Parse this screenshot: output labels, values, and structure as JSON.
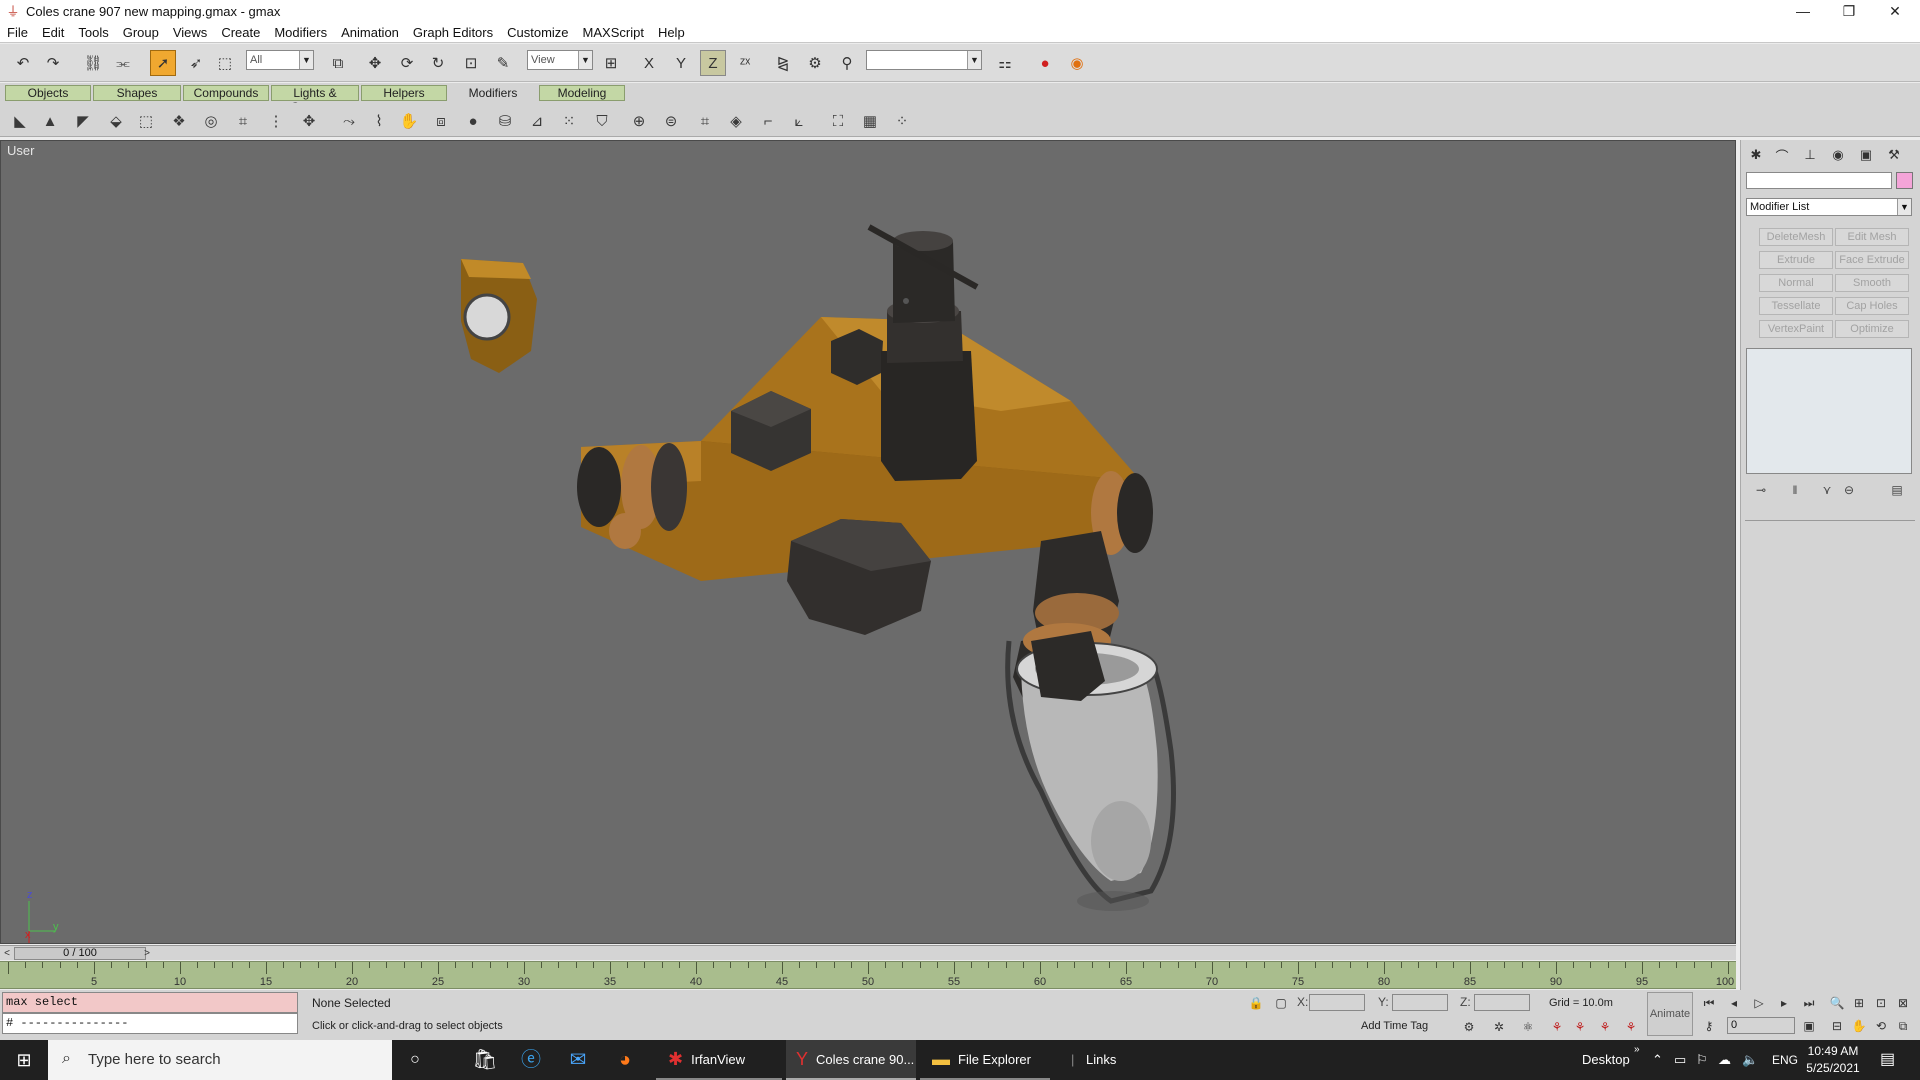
{
  "window": {
    "title": "Coles crane 907 new mapping.gmax - gmax",
    "minimize": "—",
    "maximize": "❐",
    "close": "✕"
  },
  "menu": [
    "File",
    "Edit",
    "Tools",
    "Group",
    "Views",
    "Create",
    "Modifiers",
    "Animation",
    "Graph Editors",
    "Customize",
    "MAXScript",
    "Help"
  ],
  "toolbar": {
    "selection_filter": "All",
    "reference_coord": "View",
    "named_selection": ""
  },
  "tabs": [
    "Objects",
    "Shapes",
    "Compounds",
    "Lights & Cameras",
    "Helpers",
    "Modifiers",
    "Modeling"
  ],
  "active_tab": "Modifiers",
  "viewport": {
    "label": "User",
    "axis_x": "x",
    "axis_y": "y",
    "axis_z": "z"
  },
  "command_panel": {
    "modifier_list": "Modifier List",
    "buttons": [
      "DeleteMesh",
      "Edit Mesh",
      "Extrude",
      "Face Extrude",
      "Normal",
      "Smooth",
      "Tessellate",
      "Cap Holes",
      "VertexPaint",
      "Optimize"
    ]
  },
  "timeline": {
    "frame_indicator": "0 / 100",
    "ticks": [
      5,
      10,
      15,
      20,
      25,
      30,
      35,
      40,
      45,
      50,
      55,
      60,
      65,
      70,
      75,
      80,
      85,
      90,
      95,
      100
    ],
    "frame_start": 0,
    "frame_end": 100
  },
  "status": {
    "listener_line1": "max select",
    "listener_line2": "# ---------------",
    "selection": "None Selected",
    "prompt": "Click or click-and-drag to select objects",
    "x_label": "X:",
    "y_label": "Y:",
    "z_label": "Z:",
    "grid": "Grid = 10.0m",
    "add_time_tag": "Add Time Tag",
    "animate": "Animate",
    "current_frame": "0"
  },
  "taskbar": {
    "search_placeholder": "Type here to search",
    "apps": [
      "IrfanView",
      "Coles crane 90...",
      "File Explorer"
    ],
    "links": "Links",
    "desktop": "Desktop",
    "language": "ENG",
    "time": "10:49 AM",
    "date": "5/25/2021"
  },
  "colors": {
    "viewport_bg": "#6b6b6b",
    "tab_green": "#c3d7a5",
    "trackbar_green": "#a9bd8d",
    "select_active": "#f0a830",
    "crane_body": "#b07a1e",
    "crane_dark": "#2e2c2a",
    "object_color_swatch": "#f4a4d8"
  }
}
